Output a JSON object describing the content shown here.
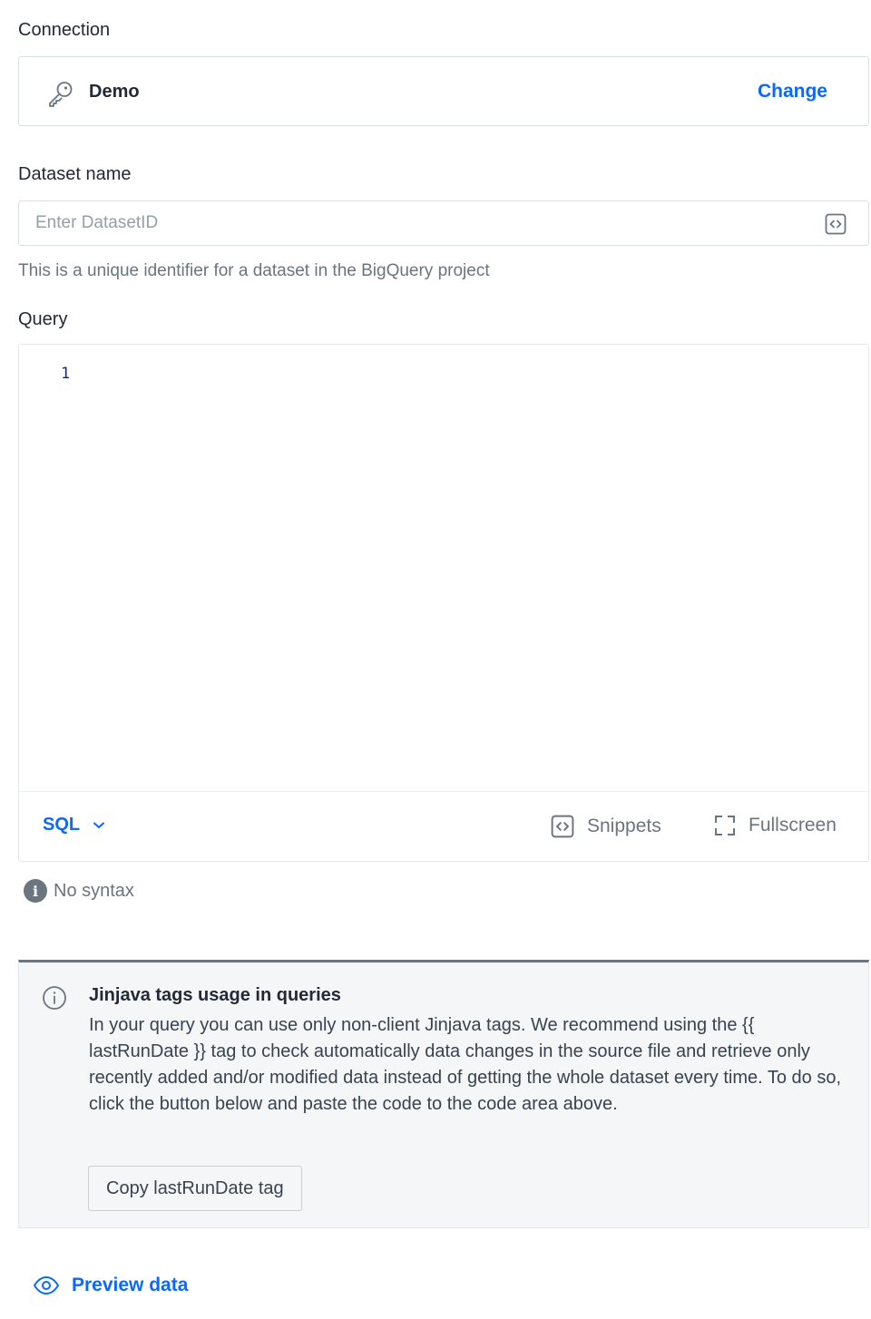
{
  "connection": {
    "label": "Connection",
    "name": "Demo",
    "change_label": "Change",
    "icon": "key-icon"
  },
  "dataset": {
    "label": "Dataset name",
    "placeholder": "Enter DatasetID",
    "value": "",
    "helper": "This is a unique identifier for a dataset in the BigQuery project",
    "icon": "code-snippet-icon"
  },
  "query": {
    "label": "Query",
    "line_number": "1",
    "code": "",
    "language": "SQL",
    "snippets_label": "Snippets",
    "fullscreen_label": "Fullscreen",
    "syntax_status": "No syntax"
  },
  "notice": {
    "title": "Jinjava tags usage in queries",
    "body": "In your query you can use only non-client Jinjava tags. We recommend using the {{ lastRunDate }} tag to check automatically data changes in the source file and retrieve only recently added and/or modified data instead of getting the whole dataset every time. To do so, click the button below and paste the code to the code area above.",
    "button_label": "Copy lastRunDate tag"
  },
  "preview": {
    "label": "Preview data",
    "icon": "eye-icon"
  },
  "colors": {
    "accent": "#0b68ff",
    "text": "#232936",
    "muted": "#6a7580",
    "border": "#dbe0e3"
  }
}
